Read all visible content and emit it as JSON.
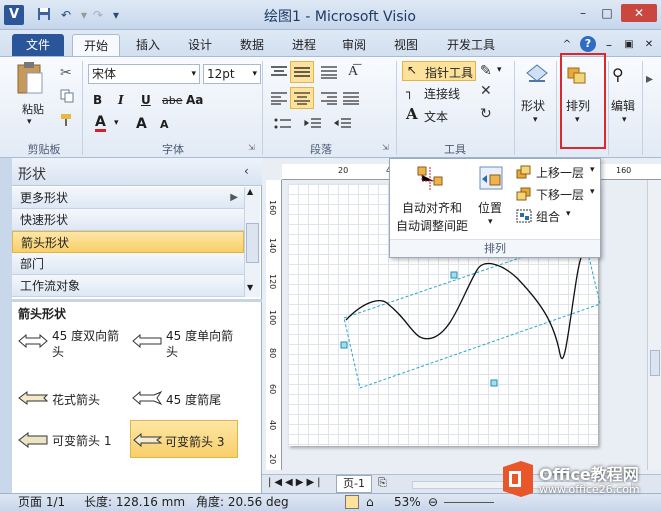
{
  "titlebar": {
    "app_icon": "V",
    "title": "绘图1 - Microsoft Visio",
    "qat": [
      "save-icon",
      "undo-icon",
      "redo-icon",
      "qat-menu-icon"
    ],
    "win_min": "–",
    "win_max": "□",
    "win_close": "✕"
  },
  "tabs": [
    "文件",
    "开始",
    "插入",
    "设计",
    "数据",
    "进程",
    "审阅",
    "视图",
    "开发工具"
  ],
  "tab_right_icons": [
    "^",
    "?",
    "–",
    "▣",
    "✕"
  ],
  "ribbon": {
    "clipboard": {
      "paste": "粘贴",
      "label": "剪贴板"
    },
    "font": {
      "family": "宋体",
      "size": "12pt",
      "label": "字体",
      "bold": "B",
      "italic": "I",
      "underline": "U",
      "strike": "abe",
      "case": "Aa",
      "color": "A",
      "grow": "A",
      "shrink": "A"
    },
    "paragraph": {
      "label": "段落"
    },
    "tools": {
      "pointer": "指针工具",
      "connector": "连接线",
      "text": "文本",
      "label": "工具"
    },
    "shape": {
      "label": "形状"
    },
    "arrange": {
      "label": "排列"
    },
    "edit": {
      "label": "编辑"
    }
  },
  "dropdown": {
    "auto_align": "自动对齐和",
    "auto_align2": "自动调整间距",
    "position": "位置",
    "bring_forward": "上移一层",
    "send_backward": "下移一层",
    "group": "组合",
    "label": "排列"
  },
  "shapes_panel": {
    "title": "形状",
    "categories": [
      "更多形状",
      "快速形状",
      "箭头形状",
      "部门",
      "工作流对象"
    ],
    "stencil_title": "箭头形状",
    "items": [
      "45 度双向箭头",
      "45 度单向箭头",
      "花式箭头",
      "45 度箭尾",
      "可变箭头 1",
      "可变箭头 3"
    ]
  },
  "ruler_top": [
    "20",
    "40",
    "160"
  ],
  "ruler_left": [
    "160",
    "140",
    "120",
    "100",
    "80",
    "60",
    "40",
    "20"
  ],
  "pagebar": {
    "page_tab": "页-1"
  },
  "statusbar": {
    "page": "页面 1/1",
    "length": "长度: 128.16 mm",
    "angle": "角度: 20.56 deg",
    "zoom": "53%"
  },
  "watermark": {
    "brand": "Office教程网",
    "url": "www.office26.com"
  },
  "colors": {
    "file_tab": "#2a5699",
    "highlight": "#f8cf6a",
    "callout": "#d9282e",
    "watermark": "#e8562a"
  }
}
